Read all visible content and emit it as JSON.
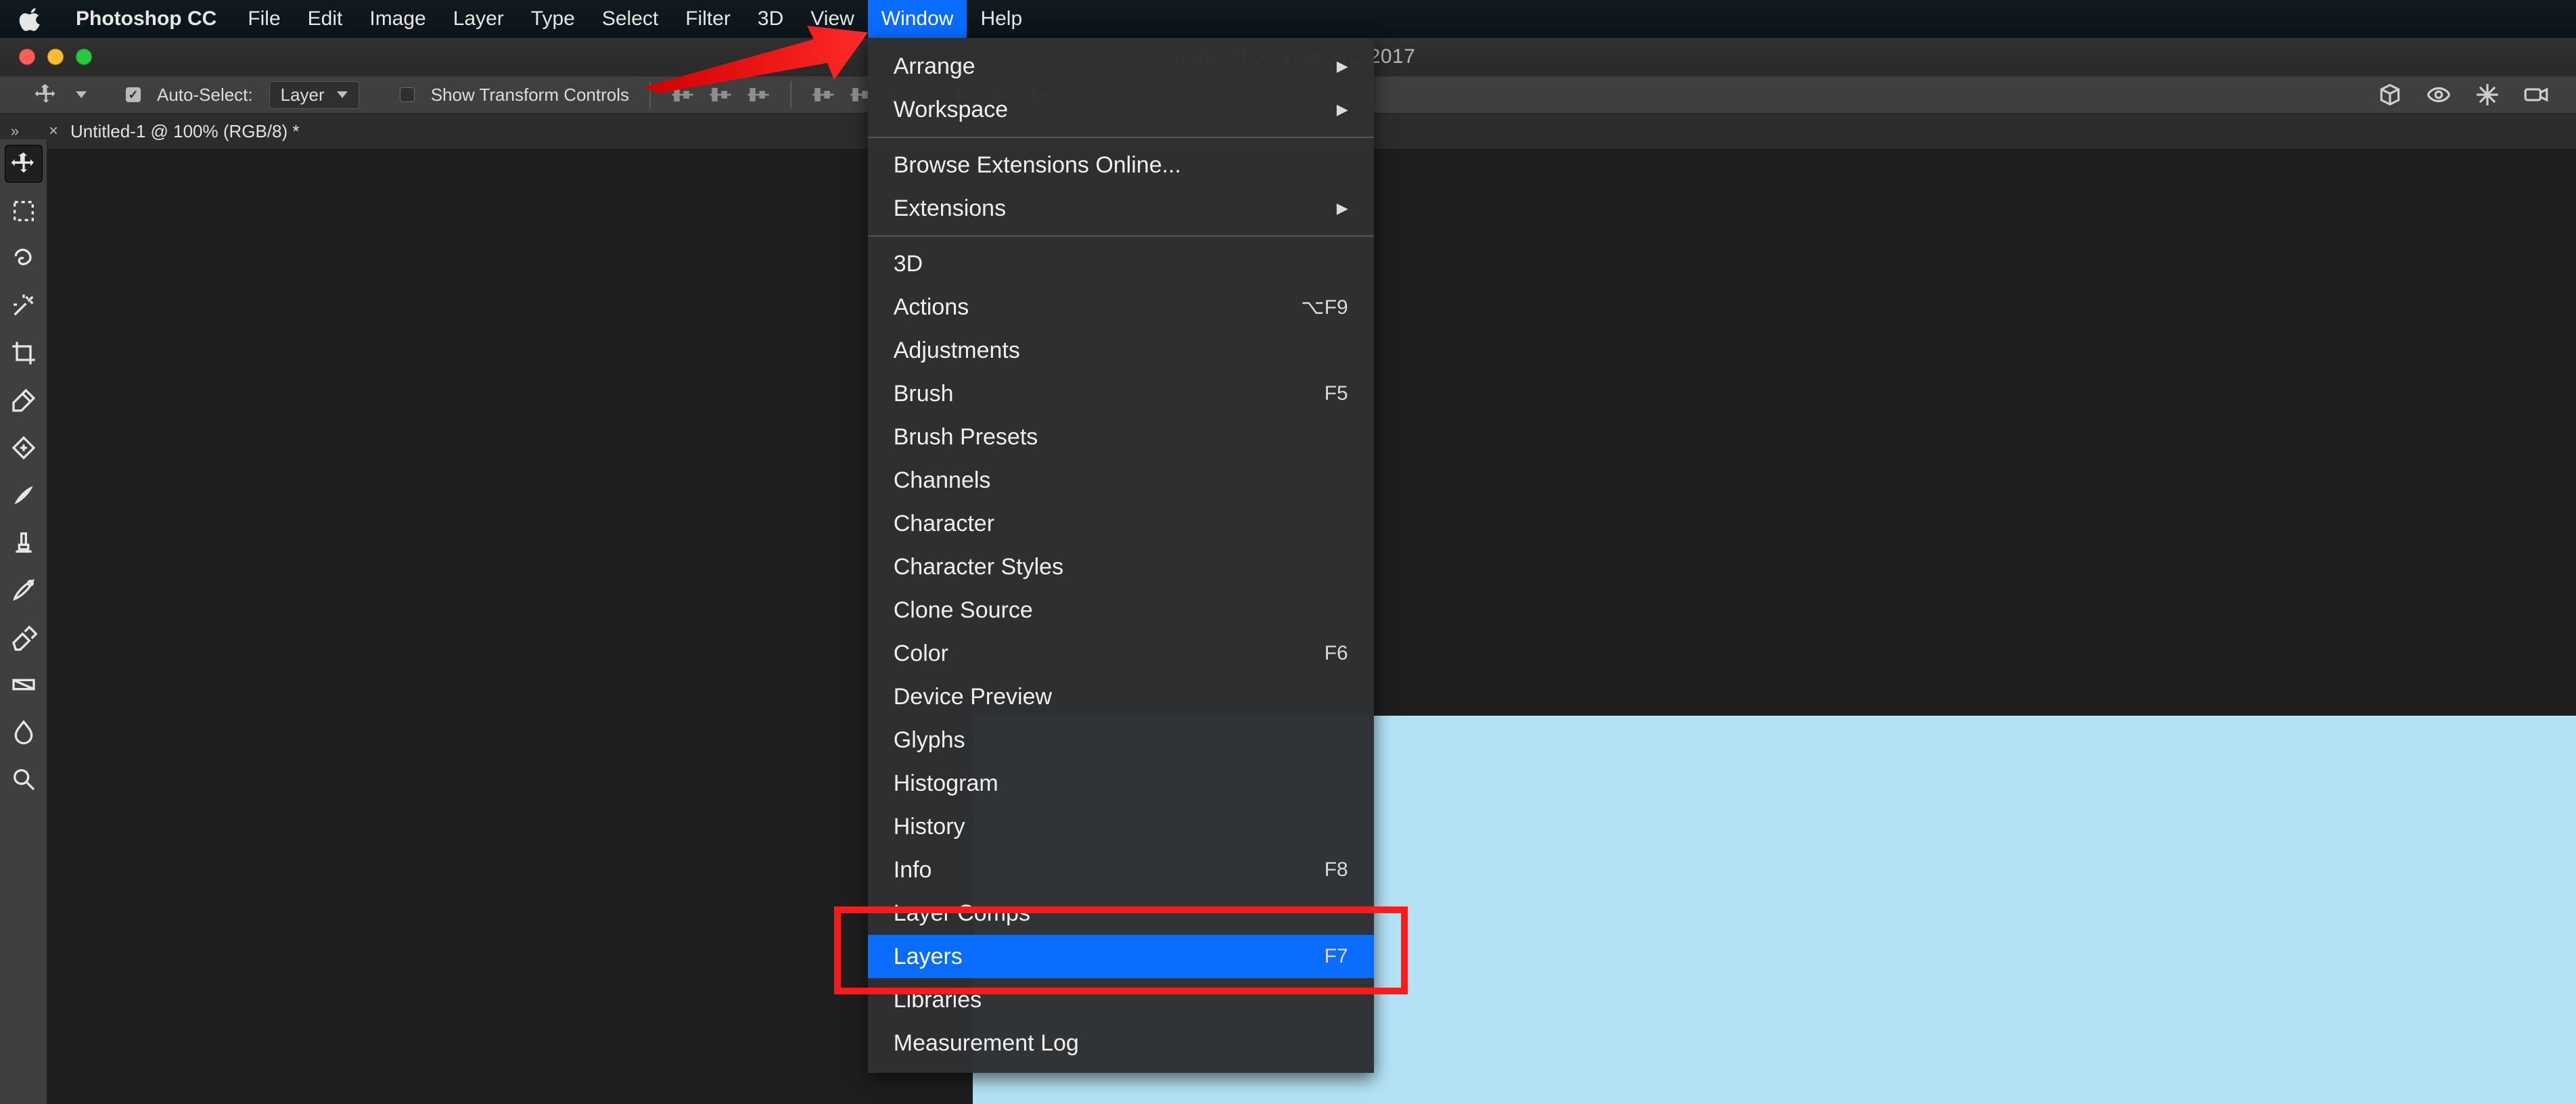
{
  "menubar": {
    "app": "Photoshop CC",
    "items": [
      "File",
      "Edit",
      "Image",
      "Layer",
      "Type",
      "Select",
      "Filter",
      "3D",
      "View",
      "Window",
      "Help"
    ],
    "selected": "Window"
  },
  "window_title": "Adobe Photoshop CC 2017",
  "options": {
    "auto_select": "Auto-Select:",
    "auto_select_checked": true,
    "layer_target": "Layer",
    "show_transform": "Show Transform Controls",
    "show_transform_checked": false
  },
  "document_tab": {
    "title": "Untitled-1 @ 100% (RGB/8) *"
  },
  "tools": [
    "move",
    "marquee",
    "lasso",
    "wand",
    "crop",
    "eyedropper",
    "heal",
    "brush",
    "stamp",
    "history-brush",
    "eraser",
    "gradient",
    "blur",
    "dodge"
  ],
  "window_menu": {
    "section1": [
      {
        "label": "Arrange",
        "submenu": true
      },
      {
        "label": "Workspace",
        "submenu": true
      }
    ],
    "section2": [
      {
        "label": "Browse Extensions Online..."
      },
      {
        "label": "Extensions",
        "submenu": true
      }
    ],
    "section3": [
      {
        "label": "3D"
      },
      {
        "label": "Actions",
        "kbd": "⌥F9"
      },
      {
        "label": "Adjustments"
      },
      {
        "label": "Brush",
        "kbd": "F5"
      },
      {
        "label": "Brush Presets"
      },
      {
        "label": "Channels"
      },
      {
        "label": "Character"
      },
      {
        "label": "Character Styles"
      },
      {
        "label": "Clone Source"
      },
      {
        "label": "Color",
        "kbd": "F6"
      },
      {
        "label": "Device Preview"
      },
      {
        "label": "Glyphs"
      },
      {
        "label": "Histogram"
      },
      {
        "label": "History"
      },
      {
        "label": "Info",
        "kbd": "F8"
      },
      {
        "label": "Layer Comps"
      },
      {
        "label": "Layers",
        "kbd": "F7",
        "selected": true,
        "highlight": true
      },
      {
        "label": "Libraries"
      },
      {
        "label": "Measurement Log"
      }
    ]
  },
  "annotation": {
    "arrow_target": "Window menu",
    "highlight": "Layers"
  }
}
